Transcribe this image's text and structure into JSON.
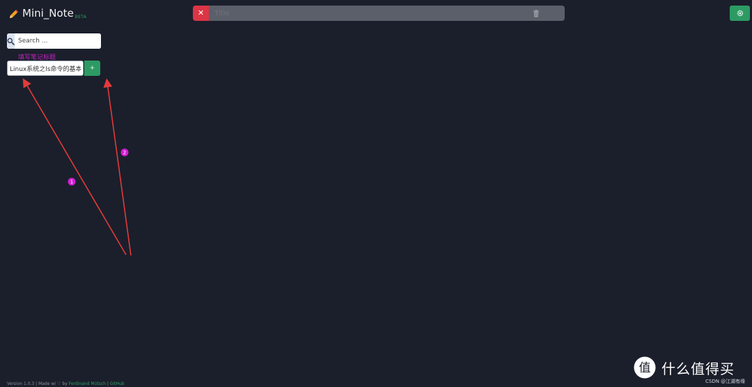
{
  "brand": {
    "icon": "pencil-icon",
    "name": "Mini_Note",
    "badge": "BETA",
    "icon_color": "#f0a020"
  },
  "titlebar": {
    "close_label": "✕",
    "title_placeholder": "Title",
    "title_value": "",
    "trash_icon": "trash-icon"
  },
  "settings": {
    "icon": "gear-icon"
  },
  "search": {
    "icon": "search-icon",
    "placeholder": "Search ..."
  },
  "annotation": {
    "label": "填写笔记标题",
    "markers": [
      "1",
      "2"
    ],
    "arrow_color": "#e23a3a",
    "marker_color": "#d21fd2"
  },
  "new_note": {
    "value": "Linux系统之ls命令的基本使用",
    "add_label": "+"
  },
  "footer": {
    "prefix": "Version 1.0.3 | Made w/ ♡ by ",
    "author": "Ferdinand Mütsch",
    "separator": " | ",
    "repo": "GitHub"
  },
  "watermark": {
    "logo_glyph": "值",
    "text": "什么值得买",
    "sub": "CSDN @江湖有缘"
  },
  "colors": {
    "background": "#1b1f2b",
    "danger": "#dc3545",
    "success": "#2d9a64",
    "titlebar": "#5b5f6a"
  }
}
